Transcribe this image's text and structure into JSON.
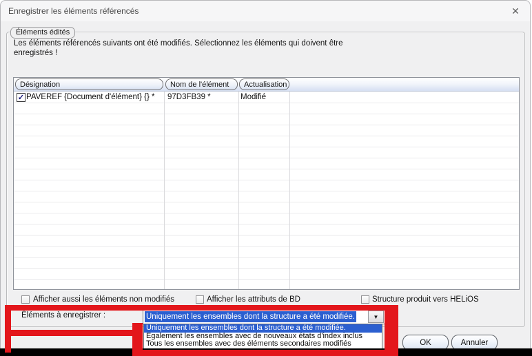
{
  "window": {
    "title": "Enregistrer les éléments référencés"
  },
  "icons": {
    "close": "✕",
    "check": "✓",
    "dropdown_arrow": "▼"
  },
  "groupbox": {
    "label": "Éléments édités",
    "description_line1": "Les éléments référencés suivants ont été modifiés. Sélectionnez les éléments qui doivent être",
    "description_line2": "enregistrés !"
  },
  "table": {
    "columns": [
      "Désignation",
      "Nom de l'élément",
      "Actualisation"
    ],
    "rows": [
      {
        "checked": true,
        "designation": "PAVEREF {Document d'élément} {} *",
        "nom": "97D3FB39 *",
        "actualisation": "Modifié"
      }
    ]
  },
  "checkboxes": [
    {
      "label": "Afficher aussi les éléments non modifiés",
      "checked": false
    },
    {
      "label": "Afficher les attributs de BD",
      "checked": false
    },
    {
      "label": "Structure produit vers HELiOS",
      "checked": false
    }
  ],
  "save_row": {
    "label": "Éléments à enregistrer :",
    "selected": "Uniquement les ensembles dont la structure a été modifiée."
  },
  "dropdown": {
    "selected_index": 0,
    "options": [
      "Uniquement les ensembles dont la structure a été modifiée.",
      "Également les ensembles avec de nouveaux états d'index inclus",
      "Tous les ensembles avec des éléments secondaires modifiés"
    ]
  },
  "buttons": {
    "ok": "OK",
    "cancel": "Annuler"
  },
  "colors": {
    "highlight": "#2b5fd0",
    "annotation": "#e3161b"
  }
}
